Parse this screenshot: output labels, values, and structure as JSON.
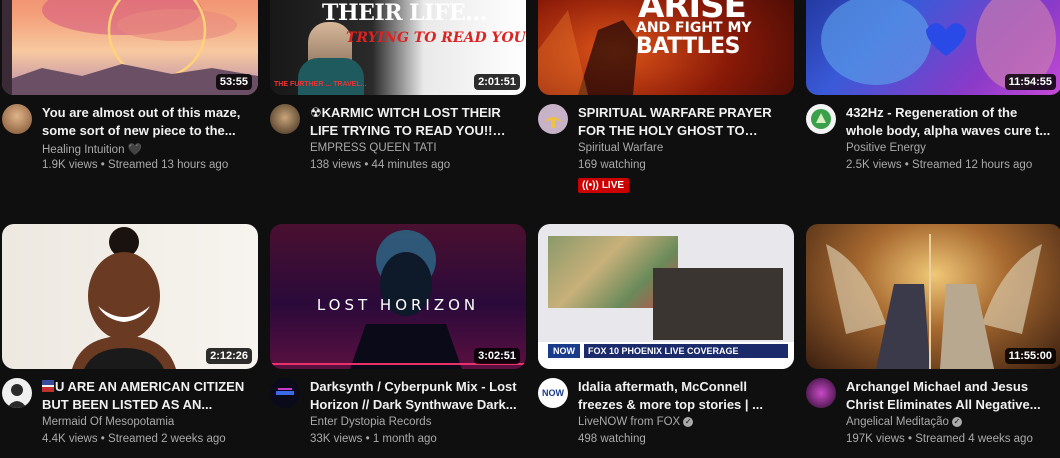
{
  "videos": [
    {
      "title": "You are almost out of this maze, some sort of new piece to the...",
      "channel": "Healing Intuition",
      "channel_suffix": "🖤",
      "stats": "1.9K views • Streamed 13 hours ago",
      "duration": "53:55"
    },
    {
      "title": "KARMIC WITCH LOST THEIR LIFE TRYING TO READ YOU!! @s...",
      "title_prefix_icon": "radiation-icon",
      "channel": "EMPRESS QUEEN TATI",
      "stats": "138 views • 44 minutes ago",
      "duration": "2:01:51",
      "thumb_text": "THEIR LIFE...",
      "thumb_sub": "TRYING TO READ YOU",
      "thumb_small": "THE FURTHER ... TRAVEL..."
    },
    {
      "title": "SPIRITUAL WARFARE PRAYER FOR THE HOLY GHOST TO WAR...",
      "channel": "Spiritual Warfare",
      "stats": "169 watching",
      "live_label": "LIVE",
      "thumb_text1": "ARISE",
      "thumb_text2": "AND FIGHT MY",
      "thumb_text3": "BATTLES"
    },
    {
      "title": "432Hz - Regeneration of the whole body, alpha waves cure t...",
      "channel": "Positive Energy",
      "stats": "2.5K views • Streamed 12 hours ago",
      "duration": "11:54:55"
    },
    {
      "title": "U ARE AN AMERICAN CITIZEN BUT BEEN LISTED AS AN...",
      "title_prefix_icon": "flag-icon",
      "channel": "Mermaid Of Mesopotamia",
      "stats": "4.4K views • Streamed 2 weeks ago",
      "duration": "2:12:26"
    },
    {
      "title": "Darksynth / Cyberpunk Mix - Lost Horizon // Dark Synthwave Dark...",
      "channel": "Enter Dystopia Records",
      "stats": "33K views • 1 month ago",
      "duration": "3:02:51",
      "thumb_text": "LOST HORIZON"
    },
    {
      "title": "Idalia aftermath, McConnell freezes & more top stories | ...",
      "channel": "LiveNOW from FOX",
      "verified": true,
      "stats": "498 watching",
      "thumb_text": "FOX 10 PHOENIX LIVE COVERAGE",
      "thumb_brand": "NOW",
      "avatar_text": "NOW"
    },
    {
      "title": "Archangel Michael and Jesus Christ Eliminates All Negative...",
      "channel": "Angelical Meditação",
      "verified": true,
      "stats": "197K views • Streamed 4 weeks ago",
      "duration": "11:55:00"
    }
  ],
  "colors": {
    "background": "#0f0f0f",
    "text_primary": "#f1f1f1",
    "text_secondary": "#aaaaaa",
    "live_badge": "#cc0000"
  }
}
